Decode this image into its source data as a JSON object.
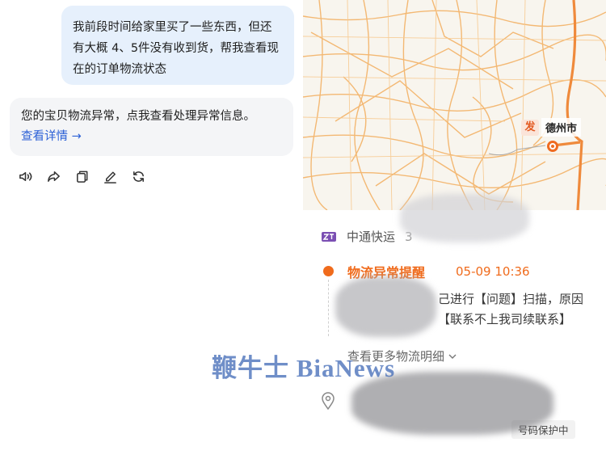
{
  "chat": {
    "user_message": "我前段时间给家里买了一些东西，但还有大概 4、5件没有收到货，帮我查看现在的订单物流状态",
    "bot_message": "您的宝贝物流异常，点我查看处理异常信息。",
    "bot_link": "查看详情 →",
    "actions": [
      "speaker-icon",
      "share-icon",
      "copy-icon",
      "edit-icon",
      "regenerate-icon"
    ]
  },
  "map": {
    "origin_badge": "发",
    "origin_city": "德州市",
    "road_color": "#f3b266",
    "highway_color": "#ef8a3c"
  },
  "logistics": {
    "carrier_name": "中通快运",
    "tracking_number_part": "3",
    "status_title": "物流异常提醒",
    "status_time": "05-09 10:36",
    "status_line1": "己进行【问题】扫描，原因",
    "status_line2": "【联系不上我司续联系】",
    "more_label": "查看更多物流明细",
    "privacy_tag": "号码保护中",
    "accent_color": "#f06b1c"
  },
  "watermark": "鞭牛士 BiaNews"
}
